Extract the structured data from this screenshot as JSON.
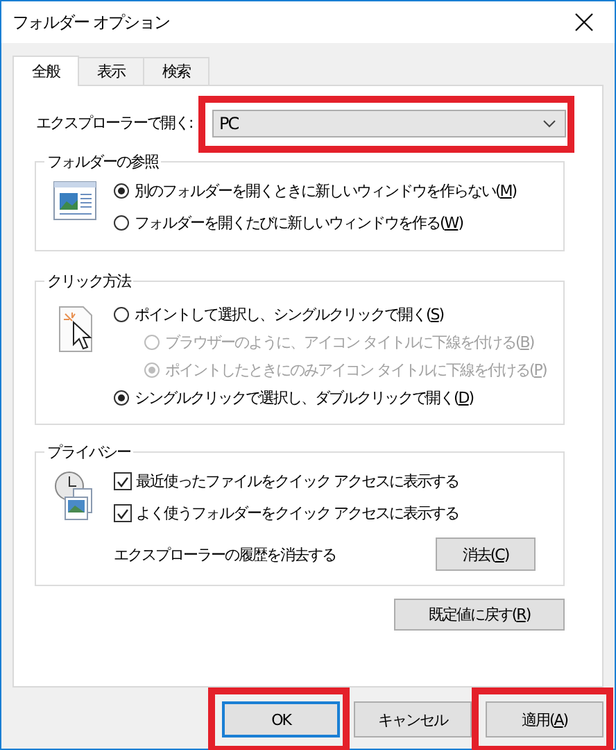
{
  "window": {
    "title": "フォルダー オプション"
  },
  "tabs": [
    {
      "label": "全般",
      "selected": true
    },
    {
      "label": "表示",
      "selected": false
    },
    {
      "label": "検索",
      "selected": false
    }
  ],
  "open_in": {
    "label": "エクスプローラーで開く:",
    "value": "PC",
    "highlighted": true
  },
  "groups": [
    {
      "title": "フォルダーの参照",
      "items": [
        {
          "kind": "radio",
          "label": [
            "別のフォルダーを開くときに新しいウィンドウを作らない(",
            "M",
            ")"
          ],
          "selected": true,
          "disabled": false
        },
        {
          "kind": "radio",
          "label": [
            "フォルダーを開くたびに新しいウィンドウを作る(",
            "W",
            ")"
          ],
          "selected": false,
          "disabled": false
        }
      ]
    },
    {
      "title": "クリック方法",
      "items": [
        {
          "kind": "radio",
          "label": [
            "ポイントして選択し、シングルクリックで開く(",
            "S",
            ")"
          ],
          "selected": false,
          "disabled": false,
          "children": [
            {
              "kind": "radio",
              "label": [
                "ブラウザーのように、アイコン タイトルに下線を付ける(",
                "B",
                ")"
              ],
              "selected": false,
              "disabled": true
            },
            {
              "kind": "radio",
              "label": [
                "ポイントしたときにのみアイコン タイトルに下線を付ける(",
                "P",
                ")"
              ],
              "selected": true,
              "disabled": true
            }
          ]
        },
        {
          "kind": "radio",
          "label": [
            "シングルクリックで選択し、ダブルクリックで開く(",
            "D",
            ")"
          ],
          "selected": true,
          "disabled": false
        }
      ]
    },
    {
      "title": "プライバシー",
      "items": [
        {
          "kind": "checkbox",
          "label": [
            "最近使ったファイルをクイック アクセスに表示する"
          ],
          "checked": true
        },
        {
          "kind": "checkbox",
          "label": [
            "よく使うフォルダーをクイック アクセスに表示する"
          ],
          "checked": true
        },
        {
          "kind": "action",
          "label": [
            "エクスプローラーの履歴を消去する"
          ],
          "button": [
            "消去(",
            "C",
            ")"
          ]
        }
      ]
    }
  ],
  "reset_button": [
    "既定値に戻す(",
    "R",
    ")"
  ],
  "buttons": [
    {
      "label": [
        "OK"
      ],
      "default": true,
      "highlighted": true
    },
    {
      "label": [
        "キャンセル"
      ],
      "default": false,
      "highlighted": false
    },
    {
      "label": [
        "適用(",
        "A",
        ")"
      ],
      "default": false,
      "highlighted": true
    }
  ]
}
